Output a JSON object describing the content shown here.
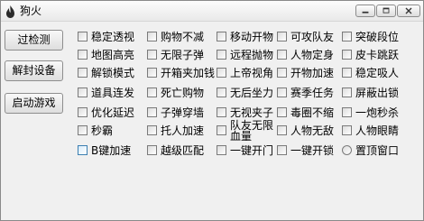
{
  "window": {
    "title": "狗火"
  },
  "side_buttons": [
    "过检测",
    "解封设备",
    "启动游戏"
  ],
  "options": [
    [
      "稳定透视",
      "购物不减",
      "移动开物",
      "可攻队友",
      "突破段位"
    ],
    [
      "地图高亮",
      "无限子弹",
      "远程抛物",
      "人物定身",
      "皮卡跳跃"
    ],
    [
      "解锁模式",
      "开箱夹加钱",
      "上帝视角",
      "开物加速",
      "稳定吸人"
    ],
    [
      "道具连发",
      "死亡购物",
      "无后坐力",
      "赛季任务",
      "屏蔽出锁"
    ],
    [
      "优化延迟",
      "子弹穿墙",
      "无视夹子",
      "毒圈不缩",
      "一炮秒杀"
    ],
    [
      "秒霸",
      "托人加速",
      "队友无限血量",
      "人物无敌",
      "人物眼睛"
    ],
    [
      "B键加速",
      "越级匹配",
      "一键开门",
      "一键开锁",
      "置顶窗口"
    ]
  ]
}
